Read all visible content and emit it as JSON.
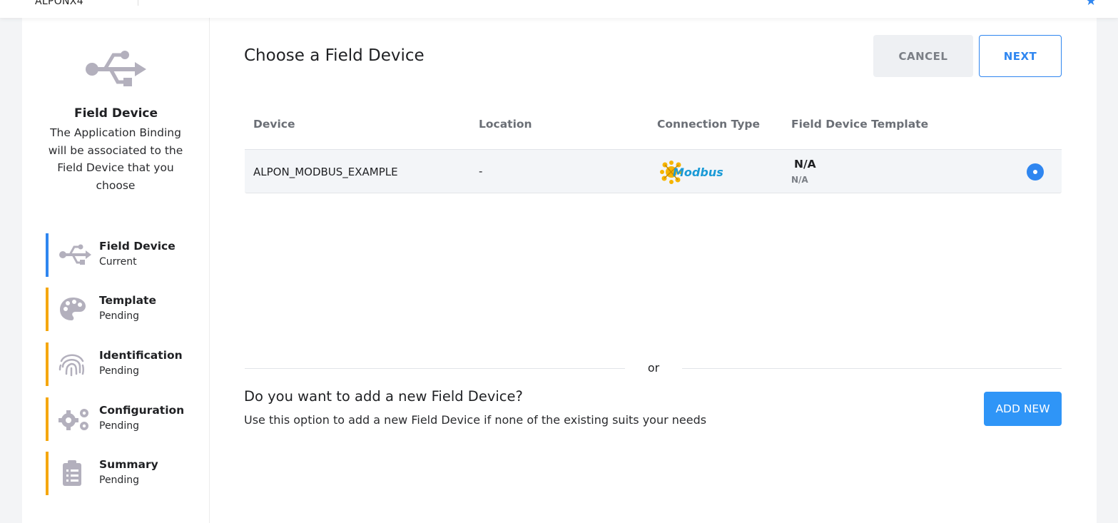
{
  "topbar": {
    "device_name": "ALPONX4"
  },
  "sidebar": {
    "title": "Field Device",
    "description": "The Application Binding will be associated to the Field Device that you choose",
    "steps": [
      {
        "label": "Field Device",
        "status": "Current",
        "icon": "usb-icon",
        "color": "#2f86f0"
      },
      {
        "label": "Template",
        "status": "Pending",
        "icon": "palette-icon",
        "color": "#f5a70f"
      },
      {
        "label": "Identification",
        "status": "Pending",
        "icon": "fingerprint-icon",
        "color": "#f5a70f"
      },
      {
        "label": "Configuration",
        "status": "Pending",
        "icon": "gears-icon",
        "color": "#f5a70f"
      },
      {
        "label": "Summary",
        "status": "Pending",
        "icon": "clipboard-icon",
        "color": "#f5a70f"
      }
    ]
  },
  "main": {
    "title": "Choose a Field Device",
    "cancel_label": "CANCEL",
    "next_label": "NEXT",
    "table": {
      "headers": [
        "Device",
        "Location",
        "Connection Type",
        "Field Device Template"
      ],
      "rows": [
        {
          "device": "ALPON_MODBUS_EXAMPLE",
          "location": "-",
          "connection_type": "Modbus",
          "template": "N/A",
          "template_sub": "N/A",
          "selected": true
        }
      ]
    },
    "or_label": "or",
    "add_new": {
      "title": "Do you want to add a new Field Device?",
      "description": "Use this option to add a new Field Device if none of the existing suits your needs",
      "button_label": "ADD NEW"
    }
  },
  "colors": {
    "accent": "#2f86f0",
    "pending": "#f5a70f",
    "add_button": "#2f95f7"
  }
}
